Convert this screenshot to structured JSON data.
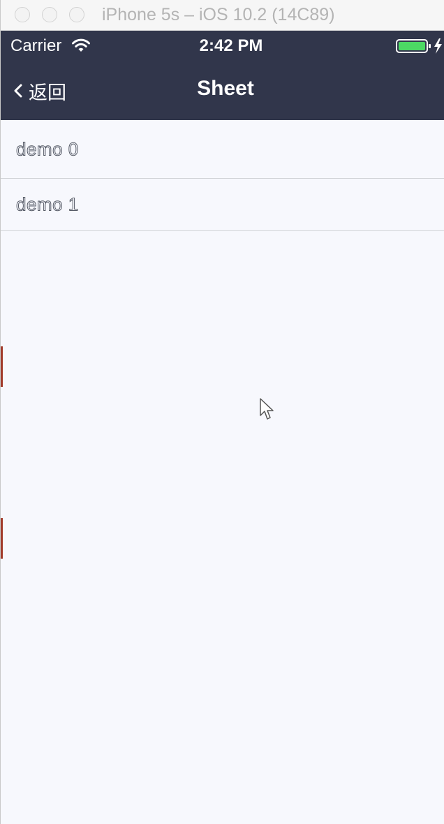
{
  "window": {
    "title": "iPhone 5s – iOS 10.2 (14C89)"
  },
  "status_bar": {
    "carrier": "Carrier",
    "time": "2:42 PM",
    "battery_color": "#4cd964",
    "bar_color": "#31364b"
  },
  "nav_bar": {
    "back_label": "返回",
    "title": "Sheet"
  },
  "list": {
    "items": [
      {
        "label": "demo 0"
      },
      {
        "label": "demo 1"
      }
    ]
  },
  "icons": {
    "wifi": "wifi-icon",
    "battery": "battery-icon",
    "charging": "bolt-icon",
    "back": "chevron-left-icon",
    "pointer": "cursor-icon"
  }
}
